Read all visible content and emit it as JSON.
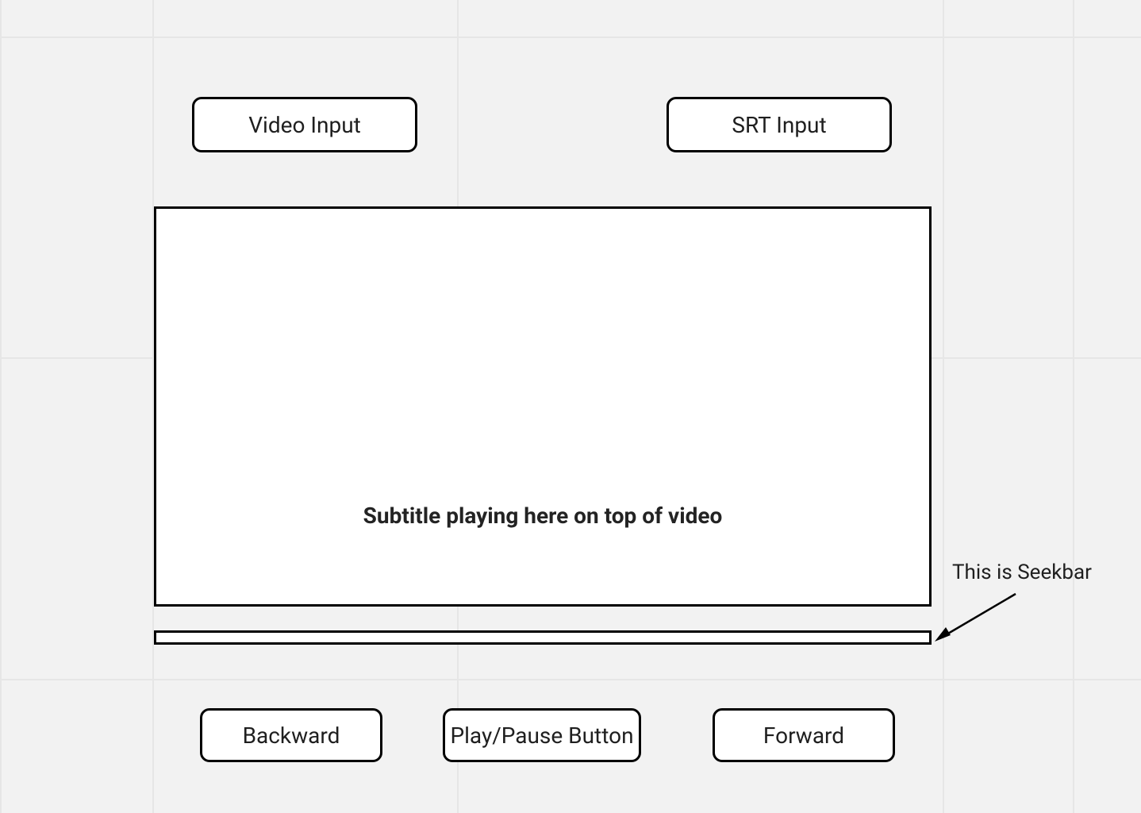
{
  "inputs": {
    "video_label": "Video Input",
    "srt_label": "SRT Input"
  },
  "video": {
    "subtitle_text": "Subtitle playing here on top of video"
  },
  "seekbar": {
    "annotation": "This is Seekbar"
  },
  "controls": {
    "backward_label": "Backward",
    "playpause_label": "Play/Pause Button",
    "forward_label": "Forward"
  }
}
